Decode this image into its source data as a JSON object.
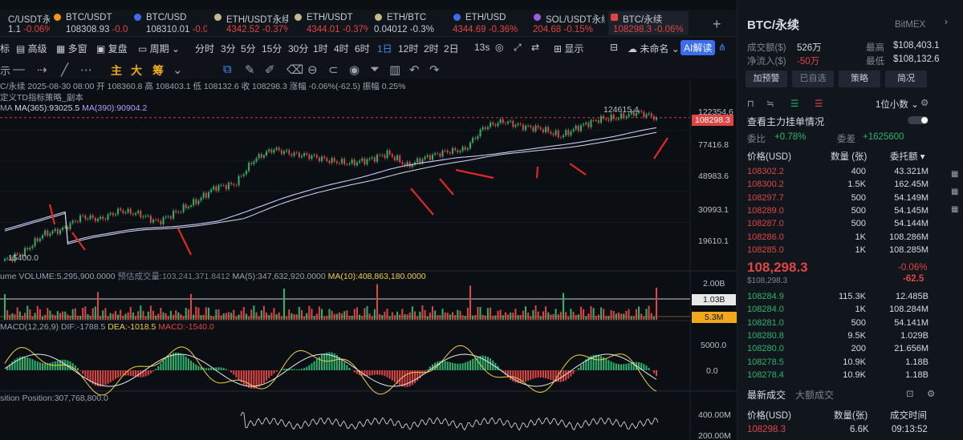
{
  "tabs": [
    {
      "name": "C/USDT永续",
      "price": "1.1",
      "change": "-0.06%",
      "icon": "",
      "color": "#e04545"
    },
    {
      "name": "BTC/USDT",
      "price": "108308.93",
      "change": "-0.06",
      "icon": "btc",
      "color": "#e04545"
    },
    {
      "name": "BTC/USD",
      "price": "108310.01",
      "change": "-0.06",
      "icon": "btc-blue",
      "color": "#e04545"
    },
    {
      "name": "ETH/USDT永续",
      "price": "4342.52",
      "change": "-0.37%",
      "icon": "eth",
      "color": "#e04545"
    },
    {
      "name": "ETH/USDT",
      "price": "4344.01",
      "change": "-0.37%",
      "icon": "eth",
      "color": "#e04545"
    },
    {
      "name": "ETH/BTC",
      "price": "0.04012",
      "change": "-0.3%",
      "icon": "eth",
      "color": "#c7ccd4"
    },
    {
      "name": "ETH/USD",
      "price": "4344.69",
      "change": "-0.36%",
      "icon": "eth-blue",
      "color": "#e04545"
    },
    {
      "name": "SOL/USDT永续",
      "price": "204.68",
      "change": "-0.15%",
      "icon": "sol",
      "color": "#e04545"
    },
    {
      "name": "BTC/永续",
      "price": "108298.3",
      "change": "-0.06%",
      "icon": "bitmex",
      "color": "#e04545"
    }
  ],
  "toolbar": {
    "items": [
      "标",
      "高级",
      "多窗",
      "复盘",
      "周期",
      "分时",
      "3分",
      "5分",
      "15分",
      "30分",
      "1时",
      "4时",
      "6时",
      "1日",
      "12时",
      "2时",
      "2日",
      "13s",
      "显示",
      "未命名",
      "AI解读"
    ],
    "selected": "1日"
  },
  "chart_info": {
    "line1": "C/永续  2025-08-30 08:00  开 108360.8  高 108403.1  低 108132.6  收 108298.3  涨幅 -0.06%(-62.5)  振幅 0.25%",
    "line2": "定义TD指标策略_副本",
    "ma_line": [
      "MA",
      "MA(365):93025.5",
      "MA(390):90904.2"
    ],
    "volume_line": [
      "ume",
      "VOLUME:5,295,900.0000",
      "预估成交量:103,241,371.8412",
      "MA(5):347,632,920.0000",
      "MA(10):408,863,180.0000"
    ],
    "macd_line": [
      "MACD(12,26,9)",
      "DIF:-1788.5",
      "DEA:-1018.5",
      "MACD:-1540.0"
    ],
    "position_line": [
      "sition",
      "Position:307,768,800.0"
    ]
  },
  "price_axis": [
    "122354.6",
    "108298.3",
    "77416.8",
    "48983.6",
    "30993.1",
    "19610.1"
  ],
  "price_marks": {
    "high": "124615.4",
    "low": "15400.0"
  },
  "volume_axis": [
    "2.00B",
    "1.03B",
    "5.3M"
  ],
  "macd_axis": [
    "5000.0",
    "0.0"
  ],
  "position_axis": [
    "400.00M",
    "200.00M"
  ],
  "sidebar": {
    "title": "BTC/永续",
    "exchange": "BitMEX",
    "stats": [
      [
        "成交额($)",
        "526万"
      ],
      [
        "最高",
        "$108,403.1"
      ],
      [
        "净流入($)",
        "-50万"
      ],
      [
        "最低",
        "$108,132.6"
      ]
    ],
    "buttons": [
      "加预警",
      "已自选",
      "策略",
      "简况"
    ],
    "depth_unit": "1位小数",
    "orders_title": "查看主力挂单情况",
    "bid_ratio": [
      "委比",
      "+0.78%",
      "委差",
      "+1625600"
    ],
    "headers": [
      "价格(USD)",
      "数量 (张)",
      "委托额"
    ],
    "asks": [
      [
        "108302.2",
        "400",
        "43.321M"
      ],
      [
        "108300.2",
        "1.5K",
        "162.45M"
      ],
      [
        "108297.7",
        "500",
        "54.149M"
      ],
      [
        "108289.0",
        "500",
        "54.145M"
      ],
      [
        "108287.0",
        "500",
        "54.144M"
      ],
      [
        "108286.0",
        "1K",
        "108.286M"
      ],
      [
        "108285.0",
        "1K",
        "108.285M"
      ]
    ],
    "last_price": "108,298.3",
    "last_sub": "$108,298.3",
    "last_change": "-0.06%",
    "last_diff": "-62.5",
    "bids": [
      [
        "108284.9",
        "115.3K",
        "12.485B"
      ],
      [
        "108284.0",
        "1K",
        "108.284M"
      ],
      [
        "108281.0",
        "500",
        "54.141M"
      ],
      [
        "108280.8",
        "9.5K",
        "1.029B"
      ],
      [
        "108280.0",
        "200",
        "21.656M"
      ],
      [
        "108278.5",
        "10.9K",
        "1.18B"
      ],
      [
        "108278.4",
        "10.9K",
        "1.18B"
      ]
    ],
    "trade_tabs": [
      "最新成交",
      "大额成交"
    ],
    "trade_headers": [
      "价格(USD)",
      "数量(张)",
      "成交时间"
    ],
    "trades": [
      [
        "108298.3",
        "6.6K",
        "09:13:52"
      ]
    ]
  },
  "chart_data": {
    "type": "candlestick",
    "interval": "1日",
    "y_scale": "log",
    "ylim": [
      15400.0,
      124615.4
    ],
    "close_series": [
      15400,
      17200,
      22000,
      23500,
      28000,
      27000,
      30500,
      29000,
      26000,
      30000,
      34500,
      42000,
      43500,
      61000,
      70500,
      66000,
      64000,
      60000,
      58000,
      61000,
      66500,
      56000,
      63000,
      68000,
      70000,
      95000,
      103000,
      96000,
      93000,
      84000,
      96000,
      106000,
      108000,
      117000,
      108298.3
    ],
    "ma365_last": 93025.5,
    "ma390_last": 90904.2
  }
}
